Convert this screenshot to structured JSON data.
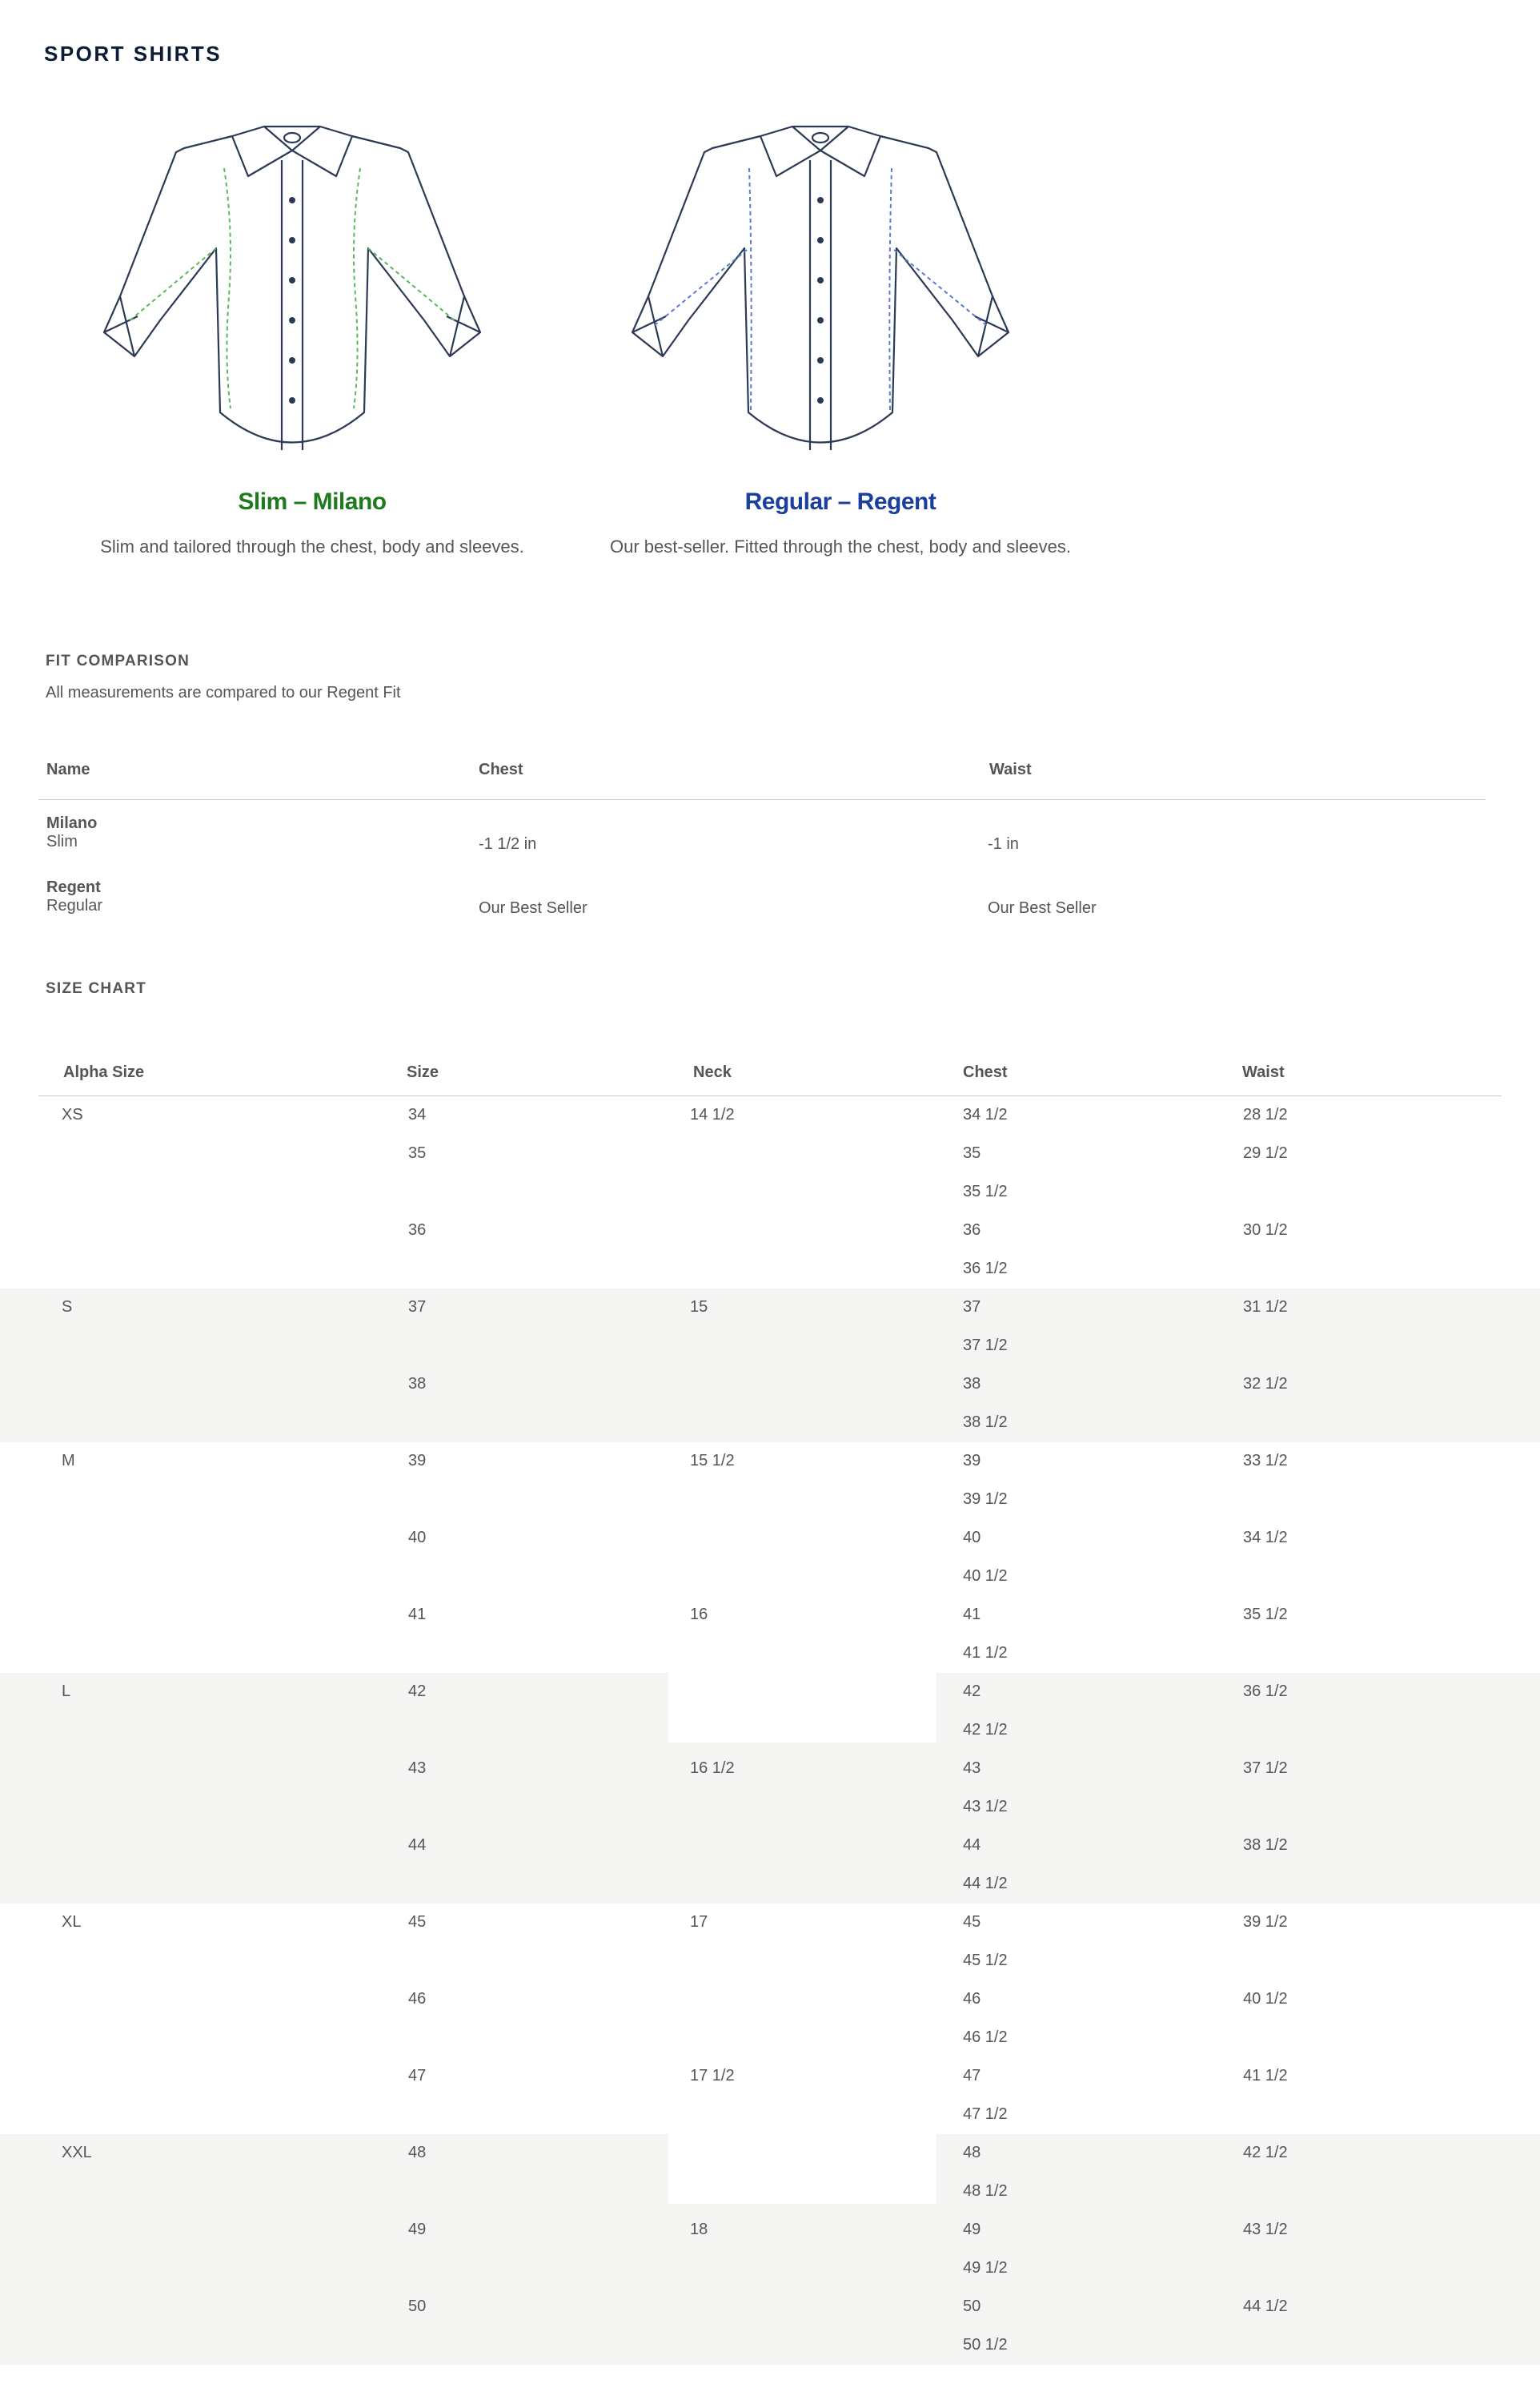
{
  "page": {
    "title": "SPORT SHIRTS"
  },
  "fits": [
    {
      "name": "Slim – Milano",
      "color": "#1f7a1f",
      "stitch_color": "#5cb85c",
      "description": "Slim and tailored through the chest, body and sleeves."
    },
    {
      "name": "Regular – Regent",
      "color": "#1b3f9e",
      "stitch_color": "#5a7ccf",
      "description": "Our best-seller. Fitted through the chest, body and sleeves."
    }
  ],
  "fit_comparison": {
    "title": "FIT COMPARISON",
    "note": "All measurements are compared to our Regent Fit",
    "headers": [
      "Name",
      "Chest",
      "Waist"
    ],
    "rows": [
      {
        "name": "Milano",
        "sub": "Slim",
        "chest": "-1 1/2 in",
        "waist": "-1 in"
      },
      {
        "name": "Regent",
        "sub": "Regular",
        "chest": "Our Best Seller",
        "waist": "Our Best Seller"
      }
    ]
  },
  "size_chart": {
    "title": "SIZE CHART",
    "headers": [
      "Alpha Size",
      "Size",
      "Neck",
      "Chest",
      "Waist"
    ],
    "groups": [
      {
        "alpha": "XS",
        "shaded": false,
        "rows": [
          {
            "size": "34",
            "neck": "14 1/2",
            "chest": "34 1/2",
            "waist": "28 1/2"
          },
          {
            "size": "35",
            "neck": "",
            "chest": "35",
            "waist": "29 1/2"
          },
          {
            "size": "",
            "neck": "",
            "chest": "35 1/2",
            "waist": ""
          },
          {
            "size": "36",
            "neck": "",
            "chest": "36",
            "waist": "30 1/2"
          },
          {
            "size": "",
            "neck": "",
            "chest": "36 1/2",
            "waist": ""
          }
        ]
      },
      {
        "alpha": "S",
        "shaded": true,
        "rows": [
          {
            "size": "37",
            "neck": "15",
            "chest": "37",
            "waist": "31 1/2"
          },
          {
            "size": "",
            "neck": "",
            "chest": "37 1/2",
            "waist": ""
          },
          {
            "size": "38",
            "neck": "",
            "chest": "38",
            "waist": "32 1/2"
          },
          {
            "size": "",
            "neck": "",
            "chest": "38 1/2",
            "waist": ""
          }
        ]
      },
      {
        "alpha": "M",
        "shaded": false,
        "rows": [
          {
            "size": "39",
            "neck": "15 1/2",
            "chest": "39",
            "waist": "33 1/2"
          },
          {
            "size": "",
            "neck": "",
            "chest": "39 1/2",
            "waist": ""
          },
          {
            "size": "40",
            "neck": "",
            "chest": "40",
            "waist": "34 1/2"
          },
          {
            "size": "",
            "neck": "",
            "chest": "40 1/2",
            "waist": ""
          },
          {
            "size": "41",
            "neck": "16",
            "chest": "41",
            "waist": "35 1/2"
          },
          {
            "size": "",
            "neck": "",
            "chest": "41 1/2",
            "waist": ""
          }
        ]
      },
      {
        "alpha": "L",
        "shaded": true,
        "rows": [
          {
            "size": "42",
            "neck": "",
            "chest": "42",
            "waist": "36 1/2"
          },
          {
            "size": "",
            "neck": "",
            "chest": "42 1/2",
            "waist": ""
          },
          {
            "size": "43",
            "neck": "16 1/2",
            "chest": "43",
            "waist": "37 1/2"
          },
          {
            "size": "",
            "neck": "",
            "chest": "43 1/2",
            "waist": ""
          },
          {
            "size": "44",
            "neck": "",
            "chest": "44",
            "waist": "38 1/2"
          },
          {
            "size": "",
            "neck": "",
            "chest": "44 1/2",
            "waist": ""
          }
        ]
      },
      {
        "alpha": "XL",
        "shaded": false,
        "rows": [
          {
            "size": "45",
            "neck": "17",
            "chest": "45",
            "waist": "39 1/2"
          },
          {
            "size": "",
            "neck": "",
            "chest": "45 1/2",
            "waist": ""
          },
          {
            "size": "46",
            "neck": "",
            "chest": "46",
            "waist": "40 1/2"
          },
          {
            "size": "",
            "neck": "",
            "chest": "46 1/2",
            "waist": ""
          },
          {
            "size": "47",
            "neck": "17 1/2",
            "chest": "47",
            "waist": "41 1/2"
          },
          {
            "size": "",
            "neck": "",
            "chest": "47 1/2",
            "waist": ""
          }
        ]
      },
      {
        "alpha": "XXL",
        "shaded": true,
        "rows": [
          {
            "size": "48",
            "neck": "",
            "chest": "48",
            "waist": "42 1/2"
          },
          {
            "size": "",
            "neck": "",
            "chest": "48 1/2",
            "waist": ""
          },
          {
            "size": "49",
            "neck": "18",
            "chest": "49",
            "waist": "43 1/2"
          },
          {
            "size": "",
            "neck": "",
            "chest": "49 1/2",
            "waist": ""
          },
          {
            "size": "50",
            "neck": "",
            "chest": "50",
            "waist": "44 1/2"
          },
          {
            "size": "",
            "neck": "",
            "chest": "50 1/2",
            "waist": ""
          }
        ]
      }
    ]
  }
}
